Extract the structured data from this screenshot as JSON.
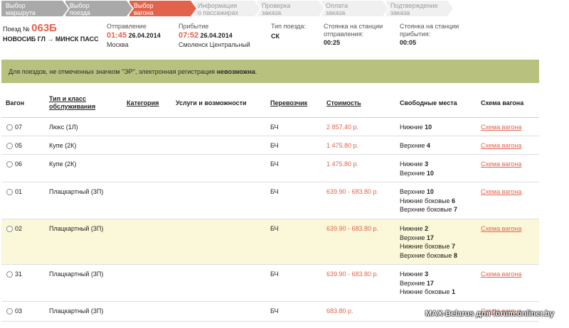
{
  "steps": [
    {
      "line1": "Выбор",
      "line2": "маршрута",
      "state": "done"
    },
    {
      "line1": "Выбор",
      "line2": "поезда",
      "state": "done"
    },
    {
      "line1": "Выбор",
      "line2": "вагона",
      "state": "active"
    },
    {
      "line1": "Информация",
      "line2": "о пассажирах",
      "state": "todo"
    },
    {
      "line1": "Проверка",
      "line2": "заказа",
      "state": "todo"
    },
    {
      "line1": "Оплата",
      "line2": "заказа",
      "state": "todo"
    },
    {
      "line1": "Подтверждение",
      "line2": "заказа",
      "state": "todo"
    }
  ],
  "train": {
    "prefix": "Поезд №",
    "number": "063Б",
    "route": "НОВОСИБ ГЛ → МИНСК ПАСС",
    "departure_label": "Отправление",
    "departure_time": "01:45",
    "departure_date": "26.04.2014",
    "departure_station": "Москва",
    "arrival_label": "Прибытие",
    "arrival_time": "07:52",
    "arrival_date": "26.04.2014",
    "arrival_station": "Смоленск Центральный",
    "type_label": "Тип поезда:",
    "type_value": "СК",
    "stop_dep_label1": "Стоянка на станции",
    "stop_dep_label2": "отправления:",
    "stop_dep_value": "00:25",
    "stop_arr_label1": "Стоянка на станции",
    "stop_arr_label2": "прибытия:",
    "stop_arr_value": "00:05"
  },
  "notice": {
    "text": "Для поездов, не отмеченных значком \"ЭР\", электронная регистрация ",
    "bold": "невозможна",
    "end": "."
  },
  "table": {
    "headers": {
      "car": "Вагон",
      "class1": "Тип и класс",
      "class2": "обслуживания",
      "category": "Категория",
      "services": "Услуги и возможности",
      "carrier": "Перевозчик",
      "price": "Стоимость",
      "seats": "Свободные места",
      "scheme": "Схема вагона"
    },
    "rows": [
      {
        "car": "07",
        "class": "Люкс (1Л)",
        "carrier": "БЧ",
        "price": "2 857.40 р.",
        "seats": [
          {
            "label": "Нижние ",
            "count": "10"
          }
        ],
        "scheme": "Схема вагона",
        "highlight": false
      },
      {
        "car": "05",
        "class": "Купе (2К)",
        "carrier": "БЧ",
        "price": "1 475.80 р.",
        "seats": [
          {
            "label": "Верхние ",
            "count": "4"
          }
        ],
        "scheme": "Схема вагона",
        "highlight": false
      },
      {
        "car": "06",
        "class": "Купе (2К)",
        "carrier": "БЧ",
        "price": "1 475.80 р.",
        "seats": [
          {
            "label": "Нижние ",
            "count": "3"
          },
          {
            "label": "Верхние ",
            "count": "10"
          }
        ],
        "scheme": "Схема вагона",
        "highlight": false
      },
      {
        "car": "01",
        "class": "Плацкартный (3П)",
        "carrier": "БЧ",
        "price": "639.90 - 683.80 р.",
        "seats": [
          {
            "label": "Верхние ",
            "count": "10"
          },
          {
            "label": "Нижние боковые ",
            "count": "6"
          },
          {
            "label": "Верхние боковые ",
            "count": "7"
          }
        ],
        "scheme": "Схема вагона",
        "highlight": false
      },
      {
        "car": "02",
        "class": "Плацкартный (3П)",
        "carrier": "БЧ",
        "price": "639.90 - 683.80 р.",
        "seats": [
          {
            "label": "Нижние ",
            "count": "2"
          },
          {
            "label": "Верхние ",
            "count": "17"
          },
          {
            "label": "Нижние боковые ",
            "count": "7"
          },
          {
            "label": "Верхние боковые ",
            "count": "8"
          }
        ],
        "scheme": "Схема вагона",
        "highlight": true
      },
      {
        "car": "31",
        "class": "Плацкартный (3П)",
        "carrier": "БЧ",
        "price": "639.90 - 683.80 р.",
        "seats": [
          {
            "label": "Нижние ",
            "count": "3"
          },
          {
            "label": "Верхние ",
            "count": "17"
          },
          {
            "label": "Нижние боковые ",
            "count": "1"
          }
        ],
        "scheme": "Схема вагона",
        "highlight": false
      },
      {
        "car": "03",
        "class": "Плацкартный (3П)",
        "carrier": "БЧ",
        "price": "683.80 р.",
        "seats": [],
        "scheme": "Схема вагона",
        "highlight": false
      }
    ]
  },
  "watermark": "MAX-Belarus для forum.onliner.by"
}
